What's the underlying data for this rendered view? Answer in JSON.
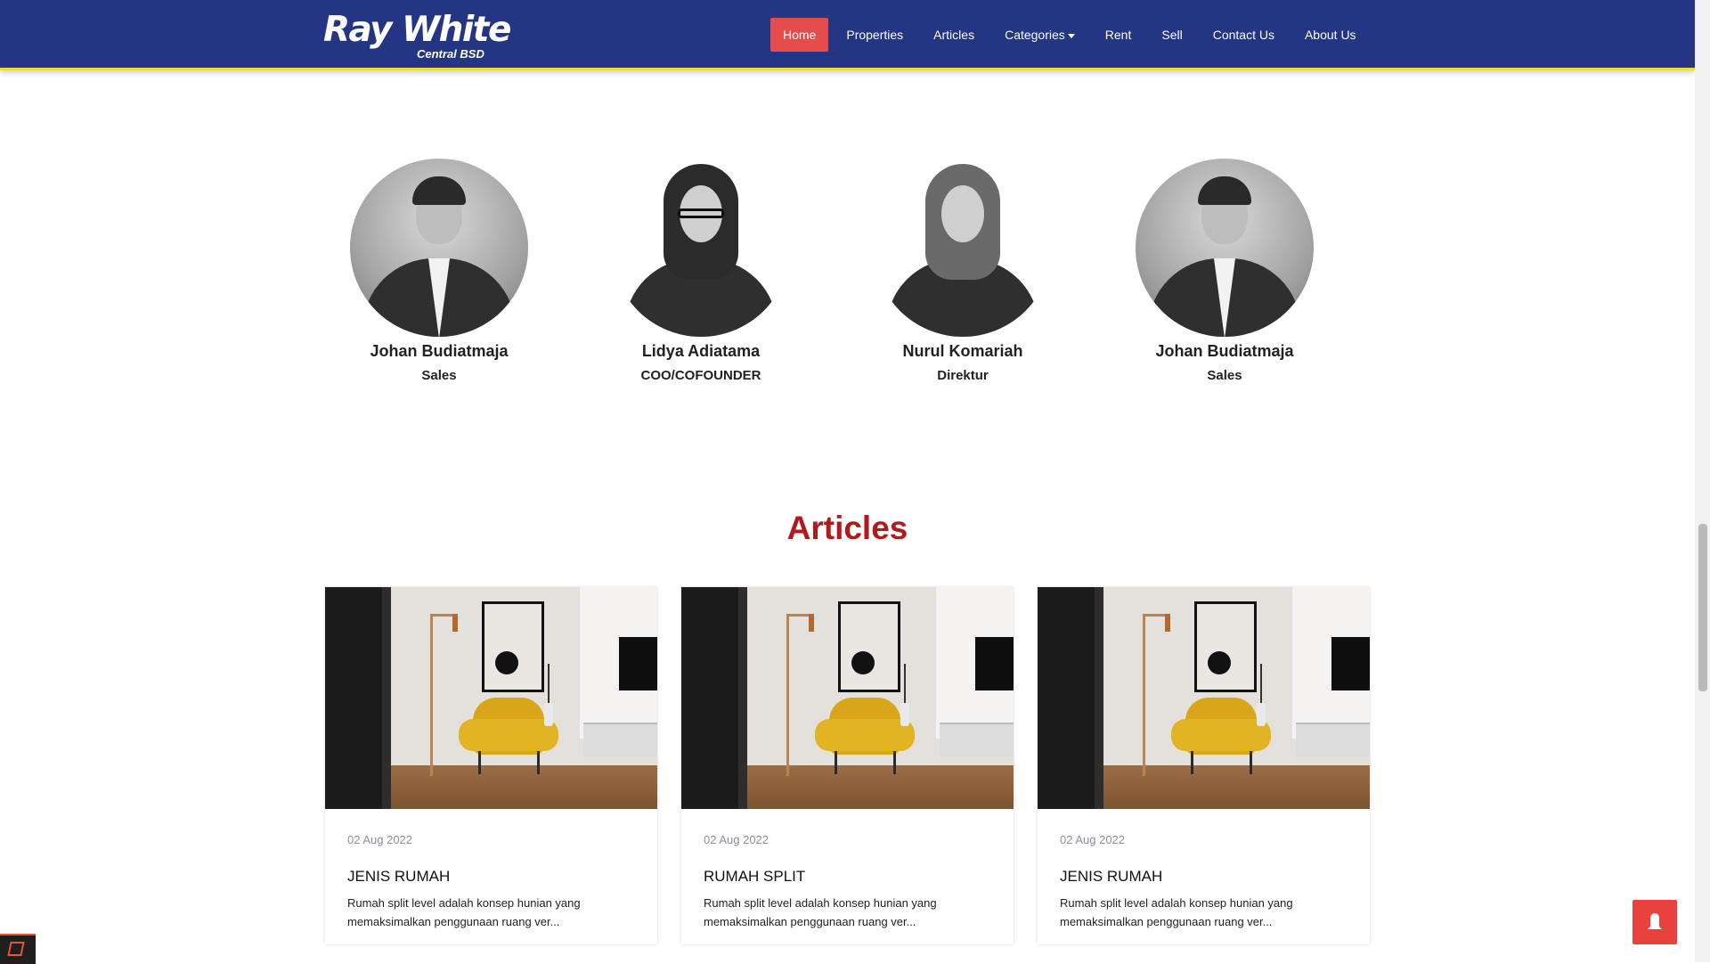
{
  "brand": {
    "name": "Ray White",
    "subtitle": "Central BSD"
  },
  "nav": {
    "items": [
      {
        "label": "Home",
        "active": true
      },
      {
        "label": "Properties"
      },
      {
        "label": "Articles"
      },
      {
        "label": "Categories",
        "has_dropdown": true
      },
      {
        "label": "Rent"
      },
      {
        "label": "Sell"
      },
      {
        "label": "Contact Us"
      },
      {
        "label": "About Us"
      }
    ]
  },
  "team": [
    {
      "name": "Johan Budiatmaja",
      "role": "Sales"
    },
    {
      "name": "Lidya Adiatama",
      "role": "COO/COFOUNDER"
    },
    {
      "name": "Nurul Komariah",
      "role": "Direktur"
    },
    {
      "name": "Johan Budiatmaja",
      "role": "Sales"
    }
  ],
  "articles": {
    "title": "Articles",
    "cards": [
      {
        "date": "02 Aug 2022",
        "title": "JENIS RUMAH",
        "excerpt": "Rumah split level adalah konsep hunian yang memaksimalkan penggunaan ruang ver..."
      },
      {
        "date": "02 Aug 2022",
        "title": "RUMAH SPLIT",
        "excerpt": "Rumah split level adalah konsep hunian yang memaksimalkan penggunaan ruang ver..."
      },
      {
        "date": "02 Aug 2022",
        "title": "JENIS RUMAH",
        "excerpt": "Rumah split level adalah konsep hunian yang memaksimalkan penggunaan ruang ver..."
      }
    ]
  },
  "colors": {
    "navbar": "#243583",
    "nav_underline": "#e6e12a",
    "accent_red": "#e74c4c",
    "articles_title": "#b11a1a",
    "date_text": "#8a8fa3"
  },
  "icons": {
    "back_to_top": "rocket-icon",
    "debugbar": "laravel-icon"
  }
}
